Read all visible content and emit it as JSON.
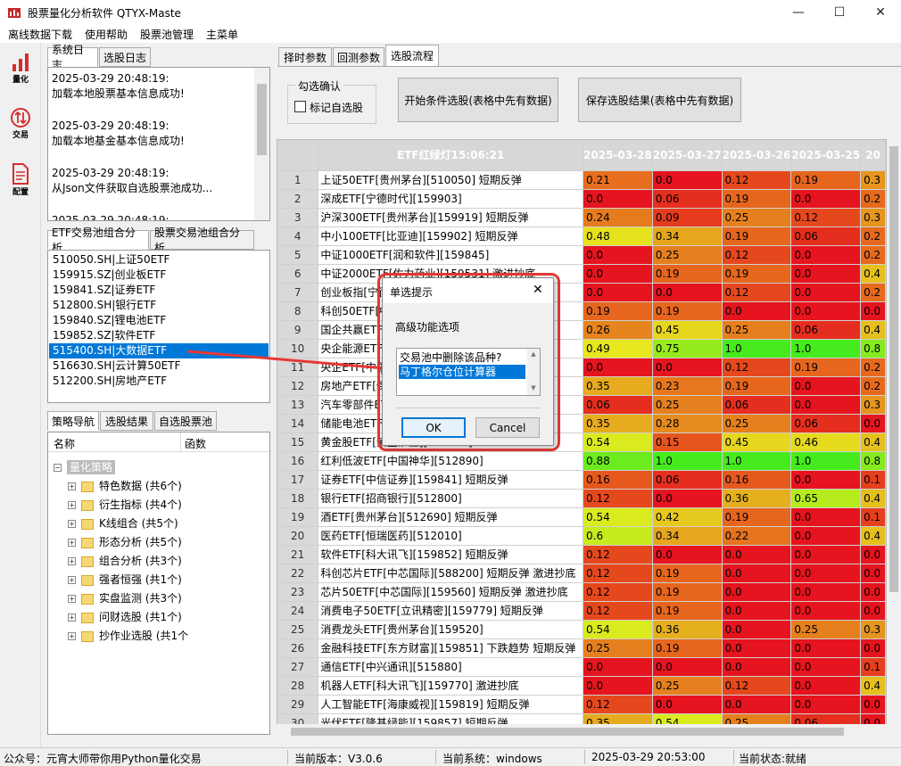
{
  "window": {
    "title": "股票量化分析软件 QTYX-Maste",
    "minimize": "—",
    "maximize": "☐",
    "close": "✕"
  },
  "menu": [
    "离线数据下载",
    "使用帮助",
    "股票池管理",
    "主菜单"
  ],
  "leftbar": [
    {
      "label": "量化",
      "icon": "bar-chart-icon"
    },
    {
      "label": "交易",
      "icon": "trade-arrows-icon"
    },
    {
      "label": "配置",
      "icon": "document-icon"
    }
  ],
  "log_tabs": [
    "系统日志",
    "选股日志"
  ],
  "log_entries": [
    {
      "time": "2025-03-29 20:48:19:",
      "msg": "加载本地股票基本信息成功!"
    },
    {
      "time": "2025-03-29 20:48:19:",
      "msg": "加载本地基金基本信息成功!"
    },
    {
      "time": "2025-03-29 20:48:19:",
      "msg": "从Json文件获取自选股票池成功..."
    },
    {
      "time": "2025-03-29 20:48:19:",
      "msg": ""
    }
  ],
  "etf_tabs": [
    "ETF交易池组合分析",
    "股票交易池组合分析"
  ],
  "etf_list": [
    "510050.SH|上证50ETF",
    "159915.SZ|创业板ETF",
    "159841.SZ|证券ETF",
    "512800.SH|银行ETF",
    "159840.SZ|锂电池ETF",
    "159852.SZ|软件ETF",
    "515400.SH|大数据ETF",
    "516630.SH|云计算50ETF",
    "512200.SH|房地产ETF"
  ],
  "etf_selected": 6,
  "strategy_tabs": [
    "策略导航",
    "选股结果",
    "自选股票池"
  ],
  "tree_headers": [
    "名称",
    "函数"
  ],
  "tree_root": "量化策略",
  "tree_items": [
    "特色数据 (共6个)",
    "衍生指标 (共4个)",
    "K线组合 (共5个)",
    "形态分析 (共5个)",
    "组合分析 (共3个)",
    "强者恒强 (共1个)",
    "实盘监测 (共3个)",
    "问财选股 (共1个)",
    "抄作业选股 (共1个"
  ],
  "right_tabs": [
    "择时参数",
    "回测参数",
    "选股流程"
  ],
  "groupbox": {
    "title": "勾选确认",
    "checkbox": "标记自选股"
  },
  "buttons": {
    "start": "开始条件选股(表格中先有数据)",
    "save": "保存选股结果(表格中先有数据)"
  },
  "table": {
    "name_header": "ETF红绿灯15:06:21",
    "date_headers": [
      "2025-03-28",
      "2025-03-27",
      "2025-03-26",
      "2025-03-25",
      "20"
    ],
    "rows": [
      {
        "n": "1",
        "name": "上证50ETF[贵州茅台][510050] 短期反弹",
        "v": [
          "0.21",
          "0.0",
          "0.12",
          "0.19",
          "0.3"
        ]
      },
      {
        "n": "2",
        "name": "深成ETF[宁德时代][159903]",
        "v": [
          "0.0",
          "0.06",
          "0.19",
          "0.0",
          "0.2"
        ]
      },
      {
        "n": "3",
        "name": "沪深300ETF[贵州茅台][159919] 短期反弹",
        "v": [
          "0.24",
          "0.09",
          "0.25",
          "0.12",
          "0.3"
        ]
      },
      {
        "n": "4",
        "name": "中小100ETF[比亚迪][159902] 短期反弹",
        "v": [
          "0.48",
          "0.34",
          "0.19",
          "0.06",
          "0.2"
        ]
      },
      {
        "n": "5",
        "name": "中证1000ETF[润和软件][159845]",
        "v": [
          "0.0",
          "0.25",
          "0.12",
          "0.0",
          "0.2"
        ]
      },
      {
        "n": "6",
        "name": "中证2000ETF[佐力药业][159531] 激进抄底",
        "v": [
          "0.0",
          "0.19",
          "0.19",
          "0.0",
          "0.4"
        ]
      },
      {
        "n": "7",
        "name": "创业板指[宁德时代][159915]",
        "v": [
          "0.0",
          "0.0",
          "0.12",
          "0.0",
          "0.2"
        ]
      },
      {
        "n": "8",
        "name": "科创50ETF[中芯国际][588000]",
        "v": [
          "0.19",
          "0.19",
          "0.0",
          "0.0",
          "0.0"
        ]
      },
      {
        "n": "9",
        "name": "国企共赢ETF[中国移动][159719]",
        "v": [
          "0.26",
          "0.45",
          "0.25",
          "0.06",
          "0.4"
        ]
      },
      {
        "n": "10",
        "name": "央企能源ETF[中国神华][561790]",
        "v": [
          "0.49",
          "0.75",
          "1.0",
          "1.0",
          "0.8"
        ]
      },
      {
        "n": "11",
        "name": "央企ETF[中国移动][510060]",
        "v": [
          "0.0",
          "0.0",
          "0.12",
          "0.19",
          "0.2"
        ]
      },
      {
        "n": "12",
        "name": "房地产ETF[保利发展][512200]",
        "v": [
          "0.35",
          "0.23",
          "0.19",
          "0.0",
          "0.2"
        ]
      },
      {
        "n": "13",
        "name": "汽车零部件ETF[拓普集团][562260] 短期反弹",
        "v": [
          "0.06",
          "0.25",
          "0.06",
          "0.0",
          "0.3"
        ]
      },
      {
        "n": "14",
        "name": "储能电池ETF[宁德时代][159566] 短期反弹",
        "v": [
          "0.35",
          "0.28",
          "0.25",
          "0.06",
          "0.0"
        ]
      },
      {
        "n": "15",
        "name": "黄金股ETF[紫金矿业][517520]",
        "v": [
          "0.54",
          "0.15",
          "0.45",
          "0.46",
          "0.4"
        ]
      },
      {
        "n": "16",
        "name": "红利低波ETF[中国神华][512890]",
        "v": [
          "0.88",
          "1.0",
          "1.0",
          "1.0",
          "0.8"
        ]
      },
      {
        "n": "17",
        "name": "证券ETF[中信证券][159841] 短期反弹",
        "v": [
          "0.16",
          "0.06",
          "0.16",
          "0.0",
          "0.1"
        ]
      },
      {
        "n": "18",
        "name": "银行ETF[招商银行][512800]",
        "v": [
          "0.12",
          "0.0",
          "0.36",
          "0.65",
          "0.4"
        ]
      },
      {
        "n": "19",
        "name": "酒ETF[贵州茅台][512690] 短期反弹",
        "v": [
          "0.54",
          "0.42",
          "0.19",
          "0.0",
          "0.1"
        ]
      },
      {
        "n": "20",
        "name": "医药ETF[恒瑞医药][512010]",
        "v": [
          "0.6",
          "0.34",
          "0.22",
          "0.0",
          "0.4"
        ]
      },
      {
        "n": "21",
        "name": "软件ETF[科大讯飞][159852] 短期反弹",
        "v": [
          "0.12",
          "0.0",
          "0.0",
          "0.0",
          "0.0"
        ]
      },
      {
        "n": "22",
        "name": "科创芯片ETF[中芯国际][588200] 短期反弹 激进抄底",
        "v": [
          "0.12",
          "0.19",
          "0.0",
          "0.0",
          "0.0"
        ]
      },
      {
        "n": "23",
        "name": "芯片50ETF[中芯国际][159560] 短期反弹 激进抄底",
        "v": [
          "0.12",
          "0.19",
          "0.0",
          "0.0",
          "0.0"
        ]
      },
      {
        "n": "24",
        "name": "消费电子50ETF[立讯精密][159779] 短期反弹",
        "v": [
          "0.12",
          "0.19",
          "0.0",
          "0.0",
          "0.0"
        ]
      },
      {
        "n": "25",
        "name": "消费龙头ETF[贵州茅台][159520]",
        "v": [
          "0.54",
          "0.36",
          "0.0",
          "0.25",
          "0.3"
        ]
      },
      {
        "n": "26",
        "name": "金融科技ETF[东方财富][159851] 下跌趋势 短期反弹",
        "v": [
          "0.25",
          "0.19",
          "0.0",
          "0.0",
          "0.0"
        ]
      },
      {
        "n": "27",
        "name": "通信ETF[中兴通讯][515880]",
        "v": [
          "0.0",
          "0.0",
          "0.0",
          "0.0",
          "0.1"
        ]
      },
      {
        "n": "28",
        "name": "机器人ETF[科大讯飞][159770] 激进抄底",
        "v": [
          "0.0",
          "0.25",
          "0.12",
          "0.0",
          "0.4"
        ]
      },
      {
        "n": "29",
        "name": "人工智能ETF[海康威视][159819] 短期反弹",
        "v": [
          "0.12",
          "0.0",
          "0.0",
          "0.0",
          "0.0"
        ]
      },
      {
        "n": "30",
        "name": "光伏ETF[隆基绿能][159857] 短期反弹",
        "v": [
          "0.35",
          "0.54",
          "0.25",
          "0.06",
          "0.0"
        ]
      }
    ]
  },
  "dialog": {
    "title": "单选提示",
    "prompt": "高级功能选项",
    "options": [
      "交易池中删除该品种?",
      "马丁格尔仓位计算器"
    ],
    "selected": 1,
    "ok": "OK",
    "cancel": "Cancel",
    "close": "✕"
  },
  "statusbar": [
    "公众号：元宵大师带你用Python量化交易",
    "当前版本：V3.0.6",
    "当前系统：windows",
    "2025-03-29 20:53:00",
    "当前状态:就绪"
  ],
  "colors": {
    "accent": "#0078d7",
    "annotation": "#e53935"
  }
}
